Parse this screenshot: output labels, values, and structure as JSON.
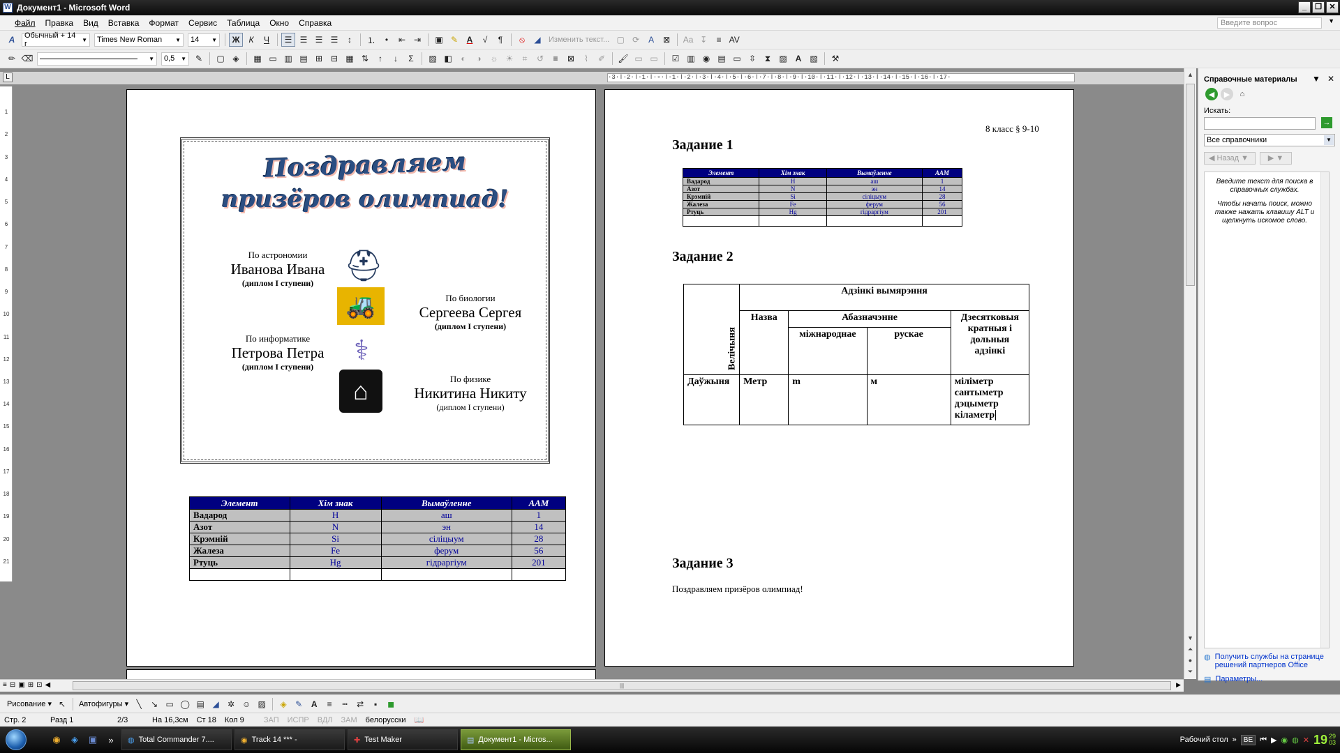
{
  "window": {
    "title": "Документ1 - Microsoft Word",
    "app_icon": "W"
  },
  "menu": {
    "items": [
      "Файл",
      "Правка",
      "Вид",
      "Вставка",
      "Формат",
      "Сервис",
      "Таблица",
      "Окно",
      "Справка"
    ],
    "ask_placeholder": "Введите вопрос"
  },
  "formatting": {
    "style": "Обычный + 14 г",
    "font": "Times New Roman",
    "size": "14",
    "bold": "Ж",
    "italic": "К",
    "underline": "Ч",
    "change_text": "Изменить текст..."
  },
  "drawing_toolbar": {
    "line_width": "0,5"
  },
  "ruler": {
    "horizontal": "·3·ǀ·2·ǀ·1·ǀ·▫·ǀ·1·ǀ·2·ǀ·3·ǀ·4·ǀ·5·ǀ·6·ǀ·7·ǀ·8·ǀ·9·ǀ·10·ǀ·11·ǀ·12·ǀ·13·ǀ·14·ǀ·15·ǀ·16·ǀ·17·",
    "vertical": [
      "1",
      "2",
      "3",
      "4",
      "5",
      "6",
      "7",
      "8",
      "9",
      "10",
      "11",
      "12",
      "13",
      "14",
      "15",
      "16",
      "17",
      "18",
      "19",
      "20",
      "21"
    ]
  },
  "page1": {
    "title_line1": "Поздравляем",
    "title_line2": "призёров олимпиад!",
    "winners": [
      {
        "subject": "По астрономии",
        "name": "Иванова Ивана",
        "degree": "(диплом I ступени)",
        "icon": "football-helmet-icon"
      },
      {
        "subject": "По биологии",
        "name": "Сергеева Сергея",
        "degree": "(диплом I ступени)",
        "icon": "tractor-icon"
      },
      {
        "subject": "По информатике",
        "name": "Петрова Петра",
        "degree": "(диплом I ступени)",
        "icon": "caduceus-icon"
      },
      {
        "subject": "По физике",
        "name": "Никитина Никиту",
        "degree": "(диплом I ступени)",
        "icon": "house-icon"
      }
    ]
  },
  "chem_table": {
    "headers": [
      "Элемент",
      "Хім знак",
      "Вымаўленне",
      "ААМ"
    ],
    "rows": [
      [
        "Вадарод",
        "H",
        "аш",
        "1"
      ],
      [
        "Азот",
        "N",
        "эн",
        "14"
      ],
      [
        "Крэмній",
        "Si",
        "сіліцыум",
        "28"
      ],
      [
        "Жалеза",
        "Fe",
        "ферум",
        "56"
      ],
      [
        "Ртуць",
        "Hg",
        "гідраргіум",
        "201"
      ]
    ]
  },
  "page2": {
    "grade": "8 класс § 9-10",
    "task1": "Задание 1",
    "task2": "Задание 2",
    "task3": "Задание 3",
    "task3_text": "Поздравляем призёров олимпиад!",
    "units_table": {
      "quantity_header": "Велічыня",
      "units_header": "Адзінкі вымярэння",
      "name_header": "Назва",
      "notation_header": "Абазначэнне",
      "intl_header": "міжнароднае",
      "ru_header": "рускае",
      "multiples_header": "Дзесятковыя кратныя і дольныя адзінкі",
      "row": {
        "quantity": "Даўжыня",
        "name": "Метр",
        "intl": "m",
        "ru": "м",
        "multiples": [
          "міліметр",
          "сантыметр",
          "дэцыметр",
          "кіламетр"
        ]
      }
    }
  },
  "task_pane": {
    "title": "Справочные материалы",
    "search_label": "Искать:",
    "search_value": "",
    "sources": "Все справочники",
    "back": "Назад",
    "hint1": "Введите текст для поиска в справочных службах.",
    "hint2": "Чтобы начать поиск, можно также нажать клавишу ALT и щелкнуть искомое слово.",
    "link1": "Получить службы на странице решений партнеров Office",
    "link2": "Параметры..."
  },
  "draw_bar": {
    "drawing": "Рисование",
    "autoshapes": "Автофигуры"
  },
  "status": {
    "page": "Стр. 2",
    "section": "Разд 1",
    "pages": "2/3",
    "at": "На 16,3см",
    "line": "Ст 18",
    "col": "Кол 9",
    "rec": "ЗАП",
    "trk": "ИСПР",
    "ext": "ВДЛ",
    "ovr": "ЗАМ",
    "lang": "белорусски"
  },
  "taskbar": {
    "tasks": [
      "Total Commander 7....",
      "Track 14 *** -",
      "Test Maker",
      "Документ1 - Micros..."
    ],
    "desktop": "Рабочий стол",
    "lang": "BE",
    "time": "19",
    "time_min_top": "29",
    "time_min_bottom": "03"
  },
  "colors": {
    "table_header": "#000080",
    "table_body": "#c0c0c0",
    "taskbar_active": "#5a7a22",
    "clock": "#9ef03a"
  }
}
